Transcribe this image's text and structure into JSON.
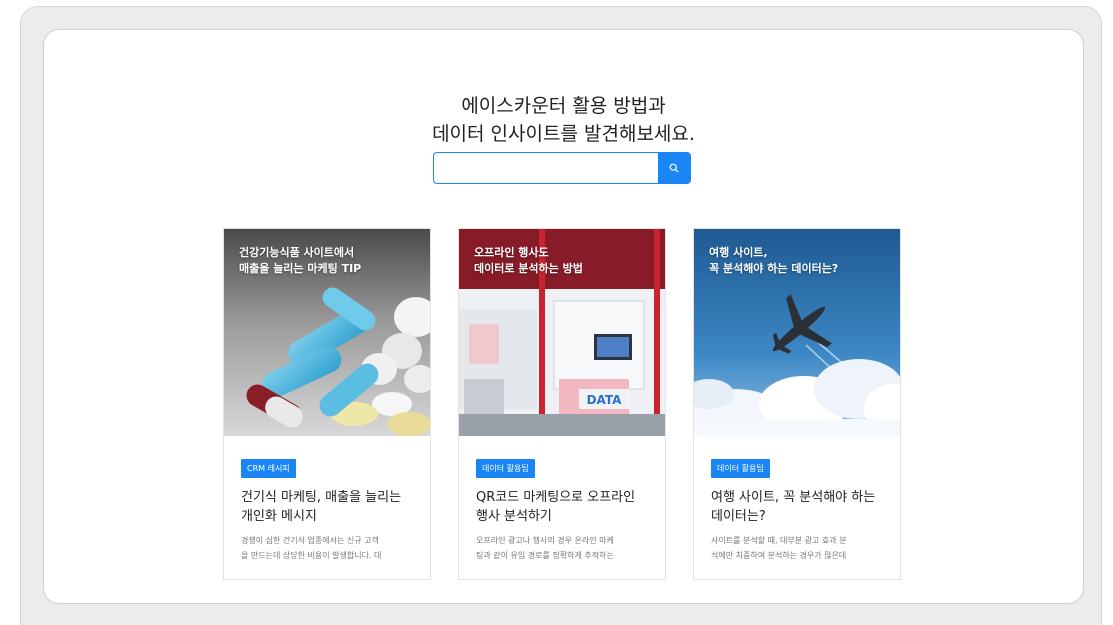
{
  "hero": {
    "line1": "에이스카운터 활용 방법과",
    "line2": "데이터 인사이트를 발견해보세요."
  },
  "search": {
    "placeholder": "",
    "value": "",
    "icon": "search-icon",
    "accent": "#1a86f5"
  },
  "cards": [
    {
      "image_title_1": "건강기능식품 사이트에서",
      "image_title_2": "매출을 늘리는 마케팅 TIP",
      "badge": "CRM 레시피",
      "title_1": "건기식 마케팅, 매출을 늘리는",
      "title_2": "개인화 메시지",
      "desc_1": "경쟁이 심한 건기식 업종에서는 신규 고객",
      "desc_2": "을 만드는데 상당한 비용이 발생합니다. 대"
    },
    {
      "image_title_1": "오프라인 행사도",
      "image_title_2": "데이터로 분석하는 방법",
      "image_sign": "DATA",
      "badge": "데이터 활용팁",
      "title_1": "QR코드 마케팅으로 오프라인",
      "title_2": "행사 분석하기",
      "desc_1": "오프라인 광고나 행사의 경우 온라인 마케",
      "desc_2": "팅과 같이 유입 경로를 정확하게 추적하는"
    },
    {
      "image_title_1": "여행 사이트,",
      "image_title_2": "꼭 분석해야 하는 데이터는?",
      "badge": "데이터 활용팁",
      "title_1": "여행 사이트, 꼭 분석해야 하는",
      "title_2": "데이터는?",
      "desc_1": "사이트를 분석할 때, 대부분 광고 효과 분",
      "desc_2": "석에만 치중하여 분석하는 경우가 많은데"
    }
  ]
}
